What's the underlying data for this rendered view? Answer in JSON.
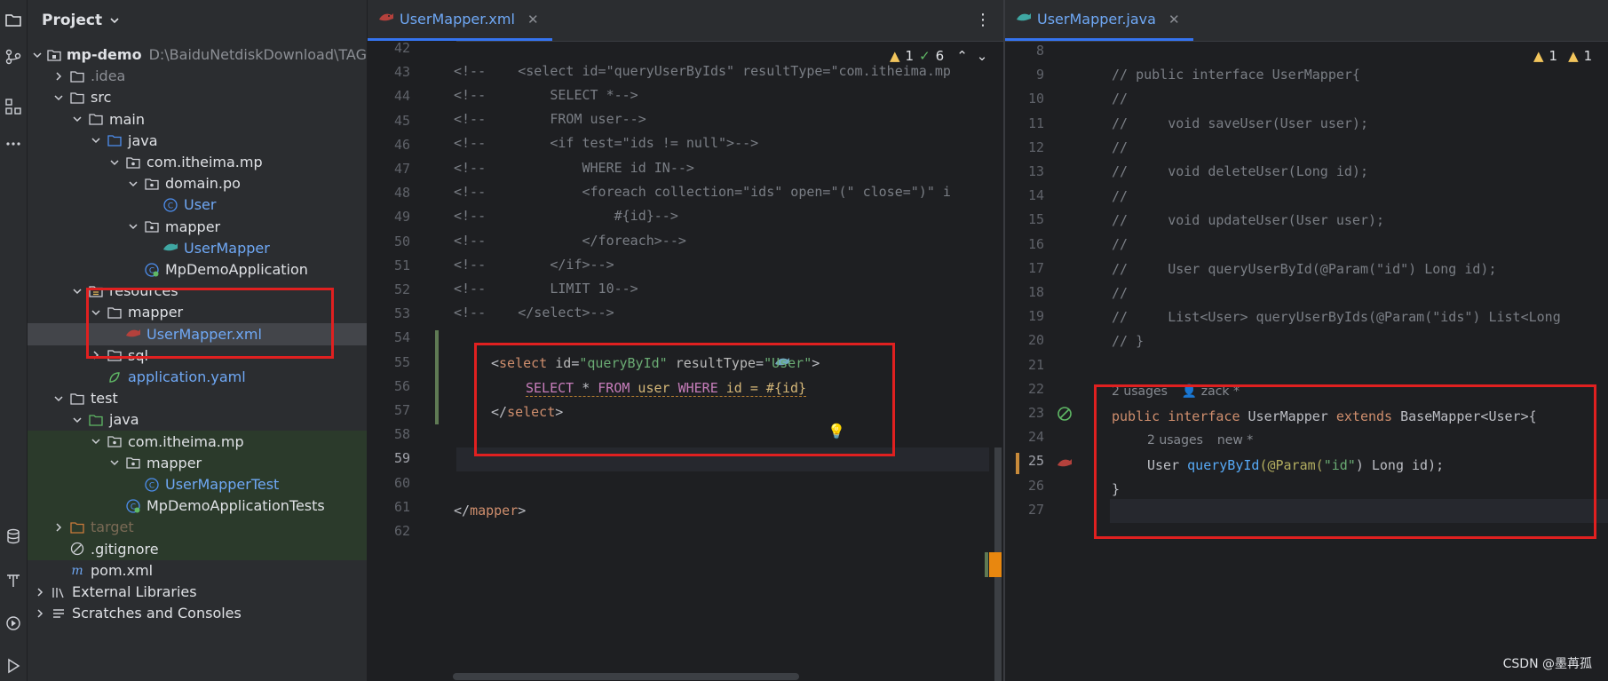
{
  "project_panel": {
    "title": "Project",
    "tree": [
      {
        "label": "mp-demo",
        "path": "D:\\BaiduNetdiskDownload\\TAG",
        "depth": 0,
        "icon": "module-folder-icon",
        "expanded": true
      },
      {
        "label": ".idea",
        "depth": 1,
        "icon": "folder-icon",
        "expanded": false
      },
      {
        "label": "src",
        "depth": 1,
        "icon": "folder-icon",
        "expanded": true
      },
      {
        "label": "main",
        "depth": 2,
        "icon": "folder-icon",
        "expanded": true
      },
      {
        "label": "java",
        "depth": 3,
        "icon": "source-folder-icon",
        "expanded": true
      },
      {
        "label": "com.itheima.mp",
        "depth": 4,
        "icon": "package-icon",
        "expanded": true
      },
      {
        "label": "domain.po",
        "depth": 5,
        "icon": "package-icon",
        "expanded": true
      },
      {
        "label": "User",
        "depth": 6,
        "icon": "class-icon"
      },
      {
        "label": "mapper",
        "depth": 5,
        "icon": "package-icon",
        "expanded": true
      },
      {
        "label": "UserMapper",
        "depth": 6,
        "icon": "mybatis-icon"
      },
      {
        "label": "MpDemoApplication",
        "depth": 5,
        "icon": "spring-class-icon"
      },
      {
        "label": "resources",
        "depth": 2,
        "icon": "resources-folder-icon",
        "expanded": true
      },
      {
        "label": "mapper",
        "depth": 3,
        "icon": "folder-icon",
        "expanded": true
      },
      {
        "label": "UserMapper.xml",
        "depth": 4,
        "icon": "mybatis-xml-icon",
        "selected": true
      },
      {
        "label": "sql",
        "depth": 3,
        "icon": "folder-icon",
        "expanded": false
      },
      {
        "label": "application.yaml",
        "depth": 3,
        "icon": "spring-config-icon"
      },
      {
        "label": "test",
        "depth": 1,
        "icon": "folder-icon",
        "expanded": true
      },
      {
        "label": "java",
        "depth": 2,
        "icon": "test-folder-icon",
        "expanded": true
      },
      {
        "label": "com.itheima.mp",
        "depth": 3,
        "icon": "package-icon",
        "expanded": true
      },
      {
        "label": "mapper",
        "depth": 4,
        "icon": "package-icon",
        "expanded": true
      },
      {
        "label": "UserMapperTest",
        "depth": 5,
        "icon": "class-icon"
      },
      {
        "label": "MpDemoApplicationTests",
        "depth": 4,
        "icon": "spring-class-icon"
      },
      {
        "label": "target",
        "depth": 1,
        "icon": "excluded-folder-icon",
        "expanded": false
      },
      {
        "label": ".gitignore",
        "depth": 1,
        "icon": "ignore-file-icon"
      },
      {
        "label": "pom.xml",
        "depth": 1,
        "icon": "maven-icon"
      },
      {
        "label": "External Libraries",
        "depth": 0,
        "icon": "libraries-icon",
        "expanded": false
      },
      {
        "label": "Scratches and Consoles",
        "depth": 0,
        "icon": "scratches-icon",
        "expanded": false
      }
    ]
  },
  "editor_xml": {
    "tab_label": "UserMapper.xml",
    "warnings": "1",
    "oks": "6",
    "lines": [
      "42",
      "43",
      "44",
      "45",
      "46",
      "47",
      "48",
      "49",
      "50",
      "51",
      "52",
      "53",
      "54",
      "55",
      "56",
      "57",
      "58",
      "59",
      "60",
      "61",
      "62"
    ],
    "code": {
      "l43": "<!--    <select id=\"queryUserByIds\" resultType=\"com.itheima.mp",
      "l44": "<!--        SELECT *-->",
      "l45": "<!--        FROM user-->",
      "l46": "<!--        <if test=\"ids != null\">-->",
      "l47": "<!--            WHERE id IN-->",
      "l48": "<!--            <foreach collection=\"ids\" open=\"(\" close=\")\" i",
      "l49": "<!--                #{id}-->",
      "l50": "<!--            </foreach>-->",
      "l51": "<!--        </if>-->",
      "l52": "<!--        LIMIT 10-->",
      "l53": "<!--    </select>-->",
      "l55_open": "<",
      "l55_tag": "select",
      "l55_attr1": "id",
      "l55_val1": "\"queryById\"",
      "l55_attr2": "resultType",
      "l55_val2": "\"User\"",
      "l55_close": ">",
      "l56_kw1": "SELECT",
      "l56_star": " * ",
      "l56_kw2": "FROM",
      "l56_tbl": " user ",
      "l56_kw3": "WHERE",
      "l56_rest": " id = #{id}",
      "l57_open": "</",
      "l57_tag": "select",
      "l57_close": ">",
      "l61_open": "</",
      "l61_tag": "mapper",
      "l61_close": ">"
    }
  },
  "editor_java": {
    "tab_label": "UserMapper.java",
    "warnings": "1",
    "warnings2": "1",
    "lines": [
      "8",
      "9",
      "10",
      "11",
      "12",
      "13",
      "14",
      "15",
      "16",
      "17",
      "18",
      "19",
      "20",
      "21",
      "22",
      "23",
      "24",
      "25",
      "26",
      "27"
    ],
    "code": {
      "l9": "// public interface UserMapper{",
      "l10": "//",
      "l11": "//     void saveUser(User user);",
      "l12": "//",
      "l13": "//     void deleteUser(Long id);",
      "l14": "//",
      "l15": "//     void updateUser(User user);",
      "l16": "//",
      "l17": "//     User queryUserById(@Param(\"id\") Long id);",
      "l18": "//",
      "l19": "//     List<User> queryUserByIds(@Param(\"ids\") List<Long",
      "l20": "// }",
      "hint1": "2 usages",
      "hint1_author": "zack *",
      "l22_kw1": "public",
      "l22_kw2": "interface",
      "l22_name": "UserMapper",
      "l22_kw3": "extends",
      "l22_base": "BaseMapper<User>{",
      "hint2": "2 usages",
      "hint2_new": "new *",
      "l23_type": "User",
      "l23_fn": "queryById",
      "l23_ann": "(@Param(",
      "l23_str": "\"id\"",
      "l23_rest": ") Long id);",
      "l24": "}"
    }
  },
  "watermark": "CSDN @墨苒孤"
}
